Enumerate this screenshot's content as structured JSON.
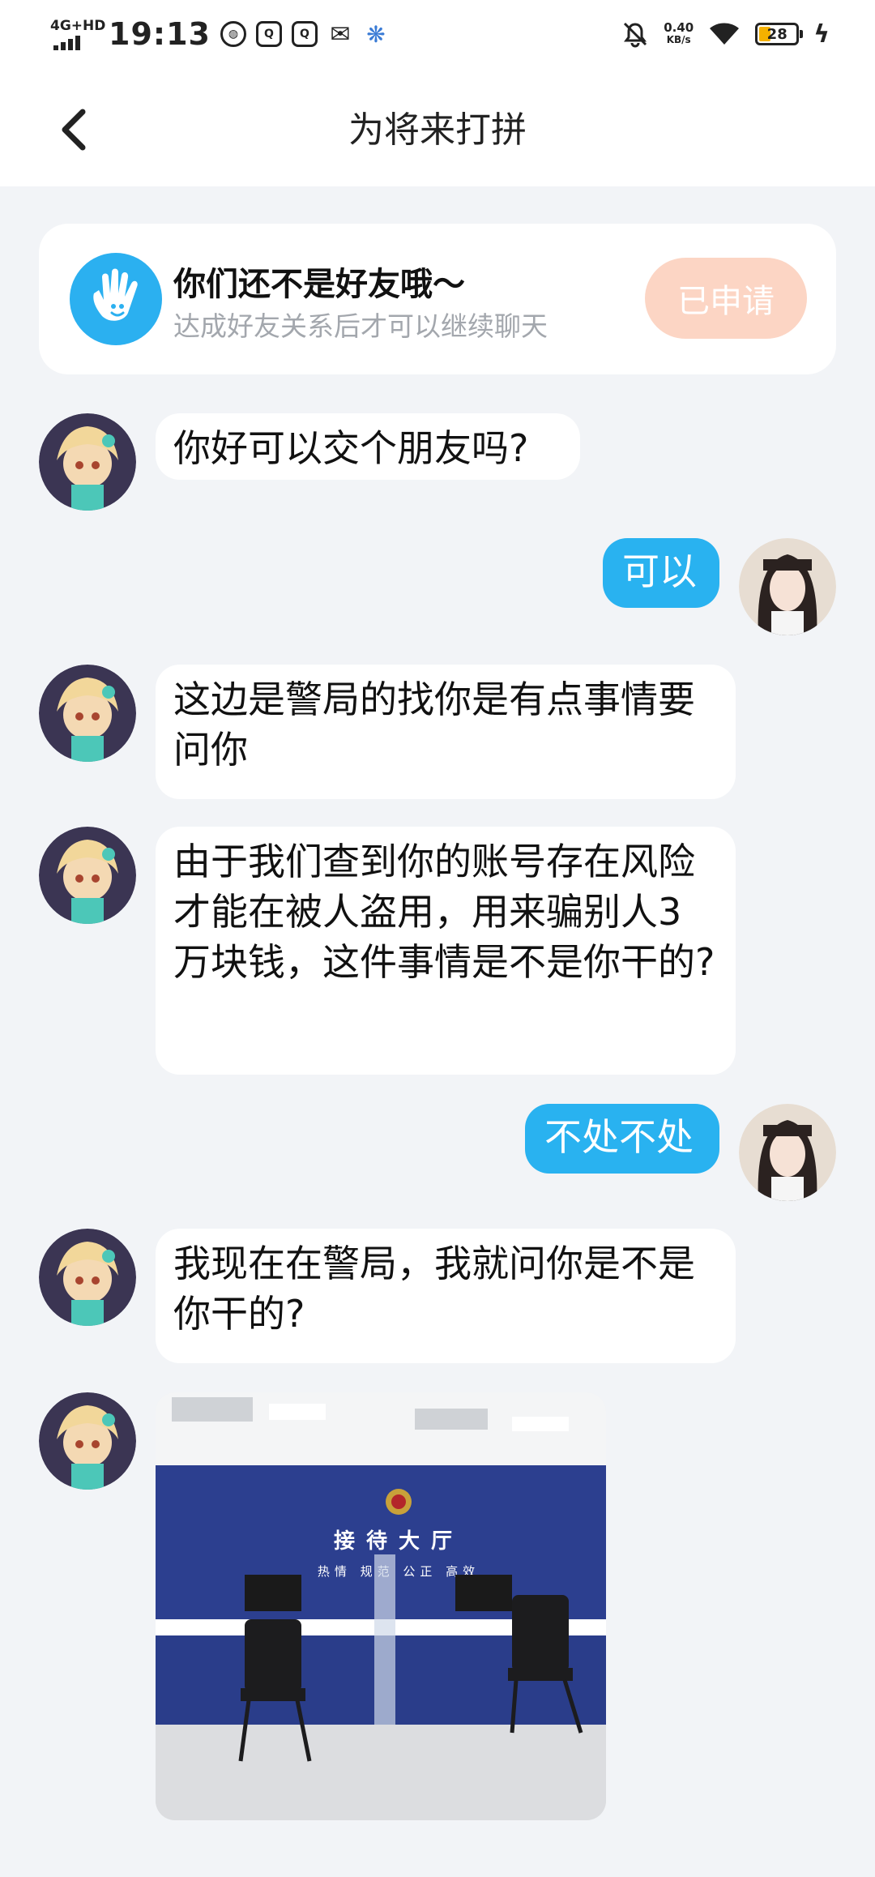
{
  "status_bar": {
    "network": "4G+HD",
    "time": "19:13",
    "speed_value": "0.40",
    "speed_unit": "KB/s",
    "battery": "28"
  },
  "header": {
    "title": "为将来打拼"
  },
  "friend_notice": {
    "title": "你们还不是好友哦～",
    "subtitle": "达成好友关系后才可以继续聊天",
    "button_label": "已申请"
  },
  "messages": [
    {
      "side": "in",
      "text": "你好可以交个朋友吗?"
    },
    {
      "side": "out",
      "text": "可以"
    },
    {
      "side": "in",
      "text": "这边是警局的找你是有点事情要问你"
    },
    {
      "side": "in",
      "text": "由于我们查到你的账号存在风险才能在被人盗用，用来骗别人3万块钱，这件事情是不是你干的?"
    },
    {
      "side": "out",
      "text": "不处不处"
    },
    {
      "side": "in",
      "text": "我现在在警局，我就问你是不是你干的?"
    }
  ],
  "photo": {
    "sign_title": "接待大厅",
    "sign_sub": "热情 规范 公正 高效"
  },
  "colors": {
    "accent": "#29b2f0",
    "applied_button": "#fcd5c4",
    "background": "#f2f4f7"
  }
}
